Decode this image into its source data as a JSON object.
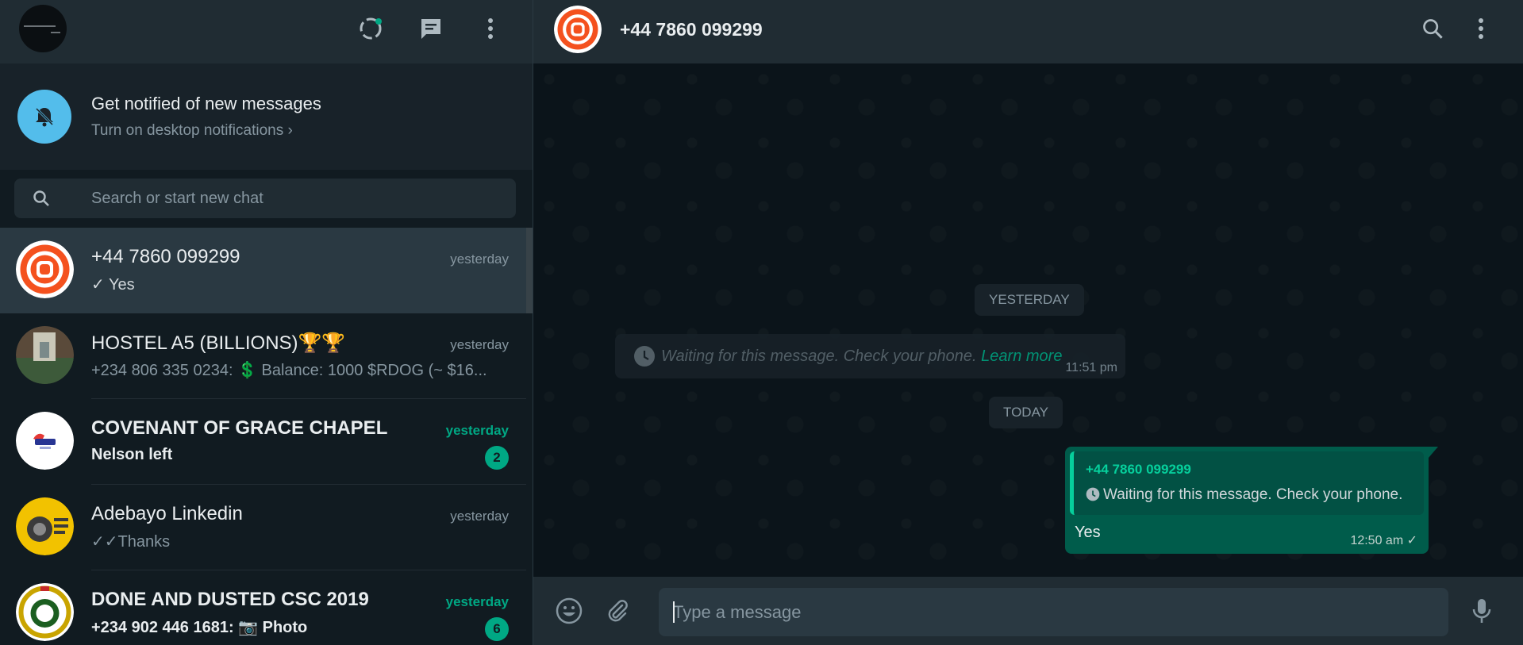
{
  "left_header": {
    "icons": [
      "status-icon",
      "new-chat-icon",
      "menu-icon"
    ]
  },
  "notification": {
    "title": "Get notified of new messages",
    "subtitle": "Turn on desktop notifications ›"
  },
  "search": {
    "placeholder": "Search or start new chat",
    "value": ""
  },
  "chats": [
    {
      "name": "+44 7860 099299",
      "time": "yesterday",
      "preview": "✓ Yes",
      "bold": false,
      "unread": null,
      "active": true
    },
    {
      "name": "HOSTEL A5 (BILLIONS)🏆🏆",
      "time": "yesterday",
      "preview": "+234 806 335 0234: 💲 Balance: 1000 $RDOG (~ $16...",
      "bold": false,
      "unread": null,
      "active": false
    },
    {
      "name": "COVENANT OF GRACE CHAPEL",
      "time": "yesterday",
      "preview": "Nelson left",
      "bold": true,
      "unread": "2",
      "active": false
    },
    {
      "name": "Adebayo Linkedin",
      "time": "yesterday",
      "preview": "✓✓Thanks",
      "bold": false,
      "unread": null,
      "active": false
    },
    {
      "name": "DONE AND DUSTED CSC 2019",
      "time": "yesterday",
      "preview": "+234 902 446 1681: 📷 Photo",
      "bold": true,
      "unread": "6",
      "active": false
    }
  ],
  "conversation": {
    "contact_name": "+44 7860 099299",
    "date_yesterday": "YESTERDAY",
    "date_today": "TODAY",
    "waiting_message": {
      "text": "Waiting for this message. Check your phone.",
      "link": "Learn more",
      "time": "11:51 pm"
    },
    "outgoing": {
      "quote_author": "+44 7860 099299",
      "quote_text": "Waiting for this message. Check your phone.",
      "text": "Yes",
      "time": "12:50 am ✓"
    }
  },
  "composer": {
    "placeholder": "Type a message",
    "value": ""
  },
  "colors": {
    "accent": "#00a884",
    "header_bg": "#202c33",
    "panel_bg": "#111b21",
    "bubble_out": "#005c4b",
    "notif_bell": "#53bdeb"
  }
}
